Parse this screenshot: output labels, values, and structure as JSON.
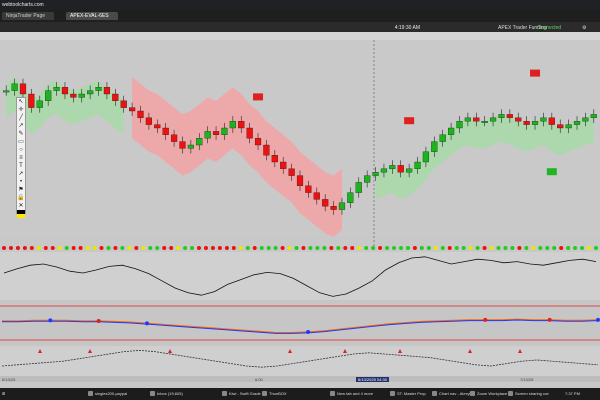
{
  "browser": {
    "url": "webtoolcharts.com"
  },
  "tabs": [
    {
      "label": "NinjaTrader Page",
      "active": false
    },
    {
      "label": "APEX-EVAL-6ES",
      "active": true
    },
    {
      "label": "",
      "active": false
    }
  ],
  "toolbar": {
    "clock": "4:19:30 AM",
    "status_1": "APEX Trader Funding",
    "status_2": "Connected"
  },
  "chart_data": {
    "type": "candlestick",
    "upColor": "#1db31d",
    "downColor": "#ee1111",
    "bullCloudColor": "#a8dba8",
    "bearCloudColor": "#f3a3a3",
    "candles_close": [
      66,
      68,
      65,
      61,
      63,
      66,
      67,
      65,
      64,
      65,
      66,
      67,
      65,
      63,
      61,
      60,
      58,
      56,
      55,
      53,
      51,
      49,
      50,
      52,
      54,
      53,
      55,
      57,
      55,
      52,
      50,
      47,
      45,
      43,
      41,
      38,
      36,
      34,
      32,
      31,
      33,
      36,
      39,
      41,
      42,
      43,
      44,
      42,
      43,
      45,
      48,
      51,
      53,
      55,
      57,
      58,
      57,
      57,
      58,
      59,
      58,
      57,
      56,
      57,
      58,
      56,
      55,
      56,
      57,
      58,
      59
    ],
    "dot_colors": [
      "red",
      "red",
      "red",
      "red",
      "red",
      "yellow",
      "red",
      "red",
      "yellow",
      "green",
      "red",
      "red",
      "yellow",
      "yellow",
      "red",
      "green",
      "red",
      "green",
      "yellow",
      "red",
      "yellow",
      "green",
      "green",
      "red",
      "red",
      "yellow",
      "green",
      "green",
      "red",
      "red",
      "red",
      "red",
      "red",
      "red",
      "yellow",
      "green",
      "red",
      "green",
      "green",
      "green",
      "red",
      "yellow",
      "green",
      "red",
      "green",
      "green",
      "green",
      "red",
      "green",
      "red",
      "red",
      "yellow",
      "green",
      "green",
      "red",
      "green",
      "green",
      "green",
      "green",
      "red",
      "green",
      "green",
      "yellow",
      "green",
      "red",
      "green",
      "green",
      "yellow",
      "green",
      "red",
      "yellow",
      "green",
      "green",
      "green",
      "red",
      "green",
      "yellow",
      "green",
      "green",
      "green",
      "red",
      "green",
      "green",
      "green",
      "yellow",
      "green"
    ],
    "osc_values": [
      5,
      12,
      18,
      20,
      15,
      8,
      5,
      10,
      16,
      18,
      12,
      4,
      -8,
      -20,
      -28,
      -32,
      -26,
      -14,
      -6,
      2,
      6,
      4,
      -4,
      -16,
      -28,
      -34,
      -30,
      -20,
      -8,
      10,
      22,
      30,
      32,
      26,
      20,
      24,
      28,
      26,
      22,
      24,
      20,
      18,
      22,
      26,
      28,
      24
    ],
    "ma_values": [
      50,
      50,
      51,
      51,
      51,
      50,
      50,
      49,
      48,
      46,
      44,
      42,
      40,
      38,
      36,
      34,
      32,
      30,
      30,
      31,
      33,
      36,
      39,
      42,
      45,
      47,
      49,
      50,
      51,
      52,
      52,
      52,
      53,
      52,
      52,
      51,
      51,
      52
    ],
    "lower_values": [
      10,
      12,
      14,
      16,
      18,
      22,
      26,
      30,
      34,
      36,
      34,
      30,
      26,
      22,
      18,
      14,
      10,
      8,
      10,
      14,
      18,
      22,
      26,
      30,
      32,
      30,
      28,
      26,
      24,
      20,
      16,
      12,
      10,
      14,
      18,
      20,
      18,
      16,
      14,
      12
    ]
  },
  "timeline": {
    "ticks": [
      "6/13/25",
      "",
      "",
      "6:00",
      "",
      "",
      "",
      "7/13/25"
    ],
    "highlight": "6/13/2025 04:30"
  },
  "toolstrip": {
    "tools": [
      "cursor-icon",
      "crosshair-icon",
      "line-icon",
      "ray-icon",
      "pen-icon",
      "rect-icon",
      "circle-icon",
      "fib-icon",
      "text-icon",
      "arrow-icon",
      "dot-icon",
      "flag-icon",
      "lock-icon",
      "trash-icon",
      "color-icon"
    ]
  },
  "taskbar": {
    "items": [
      "",
      "",
      "",
      "",
      "",
      "singles200-paypal",
      "Inbox (19,605)",
      "",
      "Kiwi - Swift Grade",
      "ThunBOX",
      "",
      "New tab and 4 more",
      "",
      "",
      "",
      "ST: Master Prop",
      "",
      "Chart nav - Alexyl",
      "Zoom Workplace",
      "Screen sharing con"
    ],
    "clock": "7:37 PM"
  }
}
